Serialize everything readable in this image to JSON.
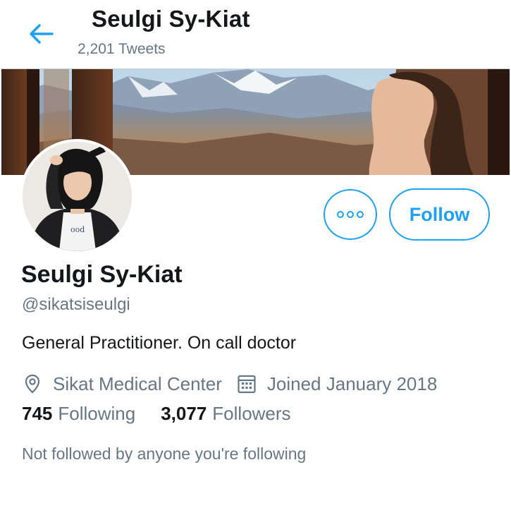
{
  "header": {
    "title": "Seulgi Sy-Kiat",
    "tweet_count": "2,201 Tweets",
    "back_icon": "arrow-left-icon"
  },
  "profile": {
    "display_name": "Seulgi Sy-Kiat",
    "handle": "@sikatsiseulgi",
    "bio": "General Practitioner. On call doctor",
    "location": "Sikat Medical Center",
    "joined": "Joined January 2018",
    "following_count": "745",
    "following_label": "Following",
    "followers_count": "3,077",
    "followers_label": "Followers",
    "not_followed_text": "Not followed by anyone you're following"
  },
  "actions": {
    "follow_label": "Follow",
    "more_icon": "more-icon"
  },
  "colors": {
    "accent": "#1da1f2",
    "text_primary": "#14171a",
    "text_secondary": "#657786"
  }
}
